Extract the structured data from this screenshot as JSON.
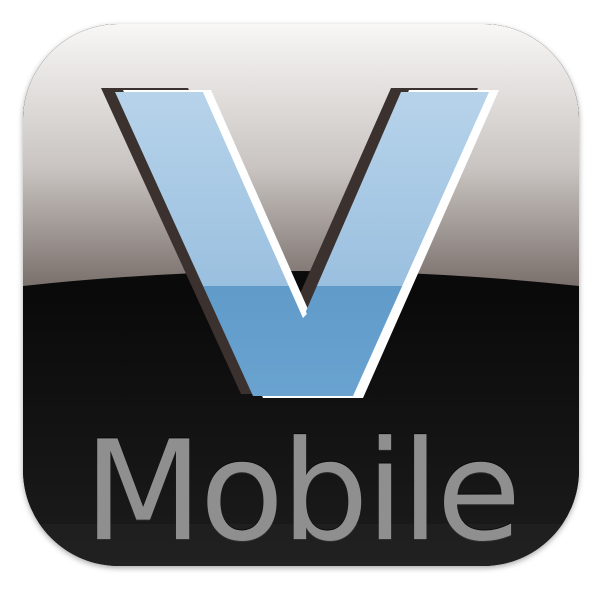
{
  "app_icon": {
    "logo_text": "V",
    "wordmark": "Mobile",
    "colors": {
      "logo_blue_light": "#a9cbe6",
      "logo_blue_dark": "#4f8fc1",
      "logo_outline": "#ffffff",
      "logo_shadow": "#3a302d",
      "gloss_top": "#f7f6f5",
      "gloss_bottom": "#7e7470",
      "body_dark": "#0b0b0b",
      "wordmark_gray": "#8f8f8f"
    }
  }
}
